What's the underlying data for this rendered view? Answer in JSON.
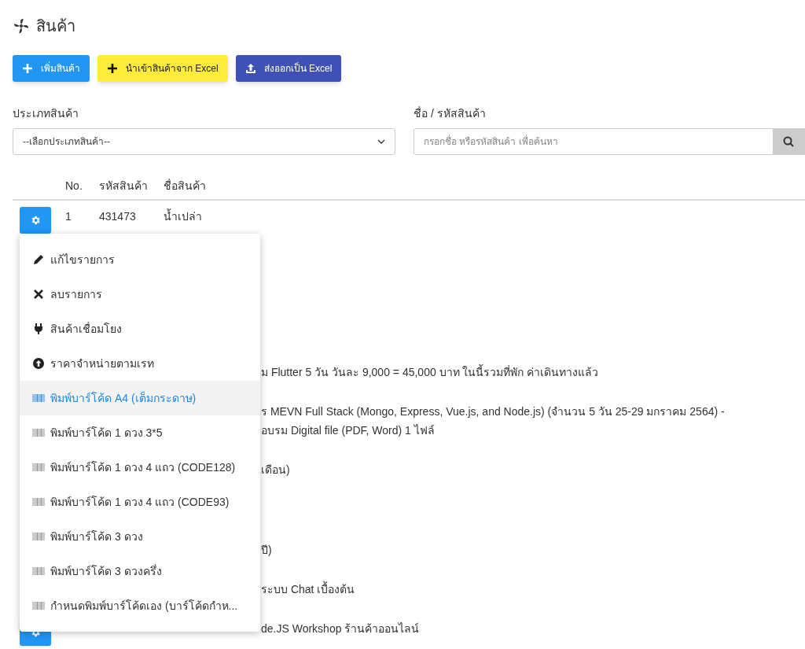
{
  "page": {
    "title": "สินค้า"
  },
  "actions": [
    {
      "kind": "add",
      "label": "เพิ่มสินค้า"
    },
    {
      "kind": "import",
      "label": "นำเข้าสินค้าจาก Excel"
    },
    {
      "kind": "export",
      "label": "ส่งออกเป็น Excel"
    }
  ],
  "filters": {
    "category": {
      "label": "ประเภทสินค้า",
      "value": "--เลือกประเภทสินค้า--"
    },
    "search": {
      "label": "ชื่อ / รหัสสินค้า",
      "placeholder": "กรอกชื่อ หรือรหัสสินค้า เพื่อค้นหา"
    }
  },
  "table": {
    "columns": [
      "No.",
      "รหัสสินค้า",
      "ชื่อสินค้า"
    ],
    "rows": [
      {
        "kind": "full",
        "no": "1",
        "code": "431473",
        "name": "น้ำเปล่า"
      },
      {
        "kind": "covered",
        "name_lines": [
          "ม Flutter 5 วัน วันละ 9,000 = 45,000 บาท ในนี้รวมที่พัก ค่าเดินทางแล้ว"
        ]
      },
      {
        "kind": "covered",
        "name_lines": [
          "ร MEVN Full Stack (Mongo, Express, Vue.js, and Node.js) (จำนวน 5 วัน 25-29 มกราคม 2564) -",
          "อบรม Digital file (PDF, Word) 1 ไฟล์"
        ]
      },
      {
        "kind": "covered",
        "name_lines": [
          "เดือน)"
        ]
      },
      {
        "kind": "covered",
        "name_lines": [
          "ปี)"
        ]
      },
      {
        "kind": "covered",
        "name_lines": [
          "ระบบ Chat เบื้องต้น"
        ]
      },
      {
        "kind": "covered",
        "gear_visible": true,
        "name_lines": [
          "de.JS Workshop ร้านค้าออนไลน์"
        ]
      }
    ]
  },
  "row_menu": {
    "items": [
      {
        "kind": "edit",
        "label": "แก้ไขรายการ",
        "selected": false
      },
      {
        "kind": "delete",
        "label": "ลบรายการ",
        "selected": false
      },
      {
        "kind": "plug",
        "label": "สินค้าเชื่อมโยง",
        "selected": false
      },
      {
        "kind": "upload",
        "label": "ราคาจำหน่ายตามเรท",
        "selected": false
      },
      {
        "kind": "barcode",
        "label": "พิมพ์บาร์โค้ด A4 (เต็มกระดาษ)",
        "selected": true
      },
      {
        "kind": "barcode",
        "label": "พิมพ์บาร์โค้ด 1 ดวง 3*5",
        "selected": false
      },
      {
        "kind": "barcode",
        "label": "พิมพ์บาร์โค้ด 1 ดวง 4 แถว (CODE128)",
        "selected": false
      },
      {
        "kind": "barcode",
        "label": "พิมพ์บาร์โค้ด 1 ดวง 4 แถว (CODE93)",
        "selected": false
      },
      {
        "kind": "barcode",
        "label": "พิมพ์บาร์โค้ด 3 ดวง",
        "selected": false
      },
      {
        "kind": "barcode",
        "label": "พิมพ์บาร์โค้ด 3 ดวงครึ่ง",
        "selected": false
      },
      {
        "kind": "barcode",
        "label": "กำหนดพิมพ์บาร์โค้ดเอง (บาร์โค้ดกำห...",
        "selected": false
      }
    ]
  }
}
